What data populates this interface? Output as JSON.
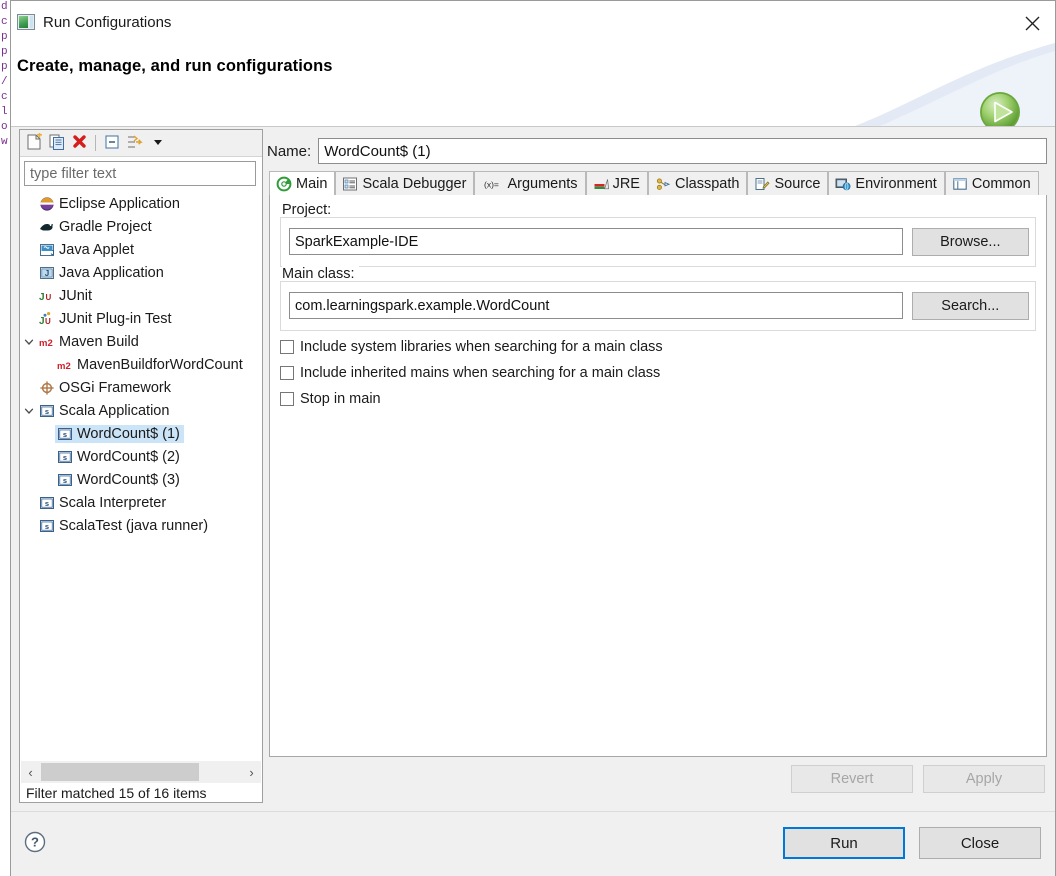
{
  "window": {
    "title": "Run Configurations",
    "title_icon": "run-config-icon",
    "close_icon": "close-icon"
  },
  "banner": {
    "heading": "Create, manage, and run configurations",
    "icon": "run-green-play-icon"
  },
  "tree_panel": {
    "toolbar": [
      {
        "name": "new-launch-configuration-icon",
        "tooltip": "New launch configuration"
      },
      {
        "name": "duplicate-icon",
        "tooltip": "Duplicate"
      },
      {
        "name": "delete-icon",
        "tooltip": "Delete"
      },
      {
        "name": "collapse-all-icon",
        "tooltip": "Collapse All"
      },
      {
        "name": "filter-icon",
        "tooltip": "Filter"
      },
      {
        "name": "chevron-down-icon",
        "tooltip": "Menu"
      }
    ],
    "filter": {
      "placeholder": "type filter text",
      "value": ""
    },
    "items": [
      {
        "label": "Eclipse Application",
        "icon": "eclipse-icon",
        "indent": 1,
        "expander": "none",
        "selected": false
      },
      {
        "label": "Gradle Project",
        "icon": "gradle-icon",
        "indent": 1,
        "expander": "none",
        "selected": false
      },
      {
        "label": "Java Applet",
        "icon": "java-applet-icon",
        "indent": 1,
        "expander": "none",
        "selected": false
      },
      {
        "label": "Java Application",
        "icon": "java-application-icon",
        "indent": 1,
        "expander": "none",
        "selected": false
      },
      {
        "label": "JUnit",
        "icon": "junit-icon",
        "indent": 1,
        "expander": "none",
        "selected": false
      },
      {
        "label": "JUnit Plug-in Test",
        "icon": "junit-plugin-icon",
        "indent": 1,
        "expander": "none",
        "selected": false
      },
      {
        "label": "Maven Build",
        "icon": "maven-icon",
        "indent": 0,
        "expander": "expanded",
        "selected": false
      },
      {
        "label": "MavenBuildforWordCount",
        "icon": "maven-icon",
        "indent": 2,
        "expander": "none",
        "selected": false
      },
      {
        "label": "OSGi Framework",
        "icon": "osgi-icon",
        "indent": 1,
        "expander": "none",
        "selected": false
      },
      {
        "label": "Scala Application",
        "icon": "scala-icon",
        "indent": 0,
        "expander": "expanded",
        "selected": false
      },
      {
        "label": "WordCount$ (1)",
        "icon": "scala-icon",
        "indent": 2,
        "expander": "none",
        "selected": true
      },
      {
        "label": "WordCount$ (2)",
        "icon": "scala-icon",
        "indent": 2,
        "expander": "none",
        "selected": false
      },
      {
        "label": "WordCount$ (3)",
        "icon": "scala-icon",
        "indent": 2,
        "expander": "none",
        "selected": false
      },
      {
        "label": "Scala Interpreter",
        "icon": "scala-icon",
        "indent": 1,
        "expander": "none",
        "selected": false
      },
      {
        "label": "ScalaTest (java runner)",
        "icon": "scala-icon",
        "indent": 1,
        "expander": "none",
        "selected": false
      }
    ],
    "scrollbar": {
      "left_arrow": "‹",
      "right_arrow": "›"
    },
    "status": "Filter matched 15 of 16 items"
  },
  "config": {
    "name_label": "Name:",
    "name_value": "WordCount$ (1)",
    "tabs": [
      {
        "label": "Main",
        "icon": "main-green-circle-icon",
        "active": true
      },
      {
        "label": "Scala Debugger",
        "icon": "scala-debugger-icon",
        "active": false
      },
      {
        "label": "Arguments",
        "icon": "arguments-icon",
        "active": false
      },
      {
        "label": "JRE",
        "icon": "jre-icon",
        "active": false
      },
      {
        "label": "Classpath",
        "icon": "classpath-icon",
        "active": false
      },
      {
        "label": "Source",
        "icon": "source-icon",
        "active": false
      },
      {
        "label": "Environment",
        "icon": "environment-icon",
        "active": false
      },
      {
        "label": "Common",
        "icon": "common-icon",
        "active": false
      }
    ],
    "project": {
      "group_label": "Project:",
      "value": "SparkExample-IDE",
      "button": "Browse..."
    },
    "main_class": {
      "group_label": "Main class:",
      "value": "com.learningspark.example.WordCount",
      "button": "Search..."
    },
    "checkboxes": [
      {
        "label": "Include system libraries when searching for a main class",
        "checked": false
      },
      {
        "label": "Include inherited mains when searching for a main class",
        "checked": false
      },
      {
        "label": "Stop in main",
        "checked": false
      }
    ],
    "revert_label": "Revert",
    "apply_label": "Apply"
  },
  "footer": {
    "help_icon": "help-question-icon",
    "run_label": "Run",
    "close_label": "Close"
  },
  "colors": {
    "selection_blue": "#cce4f7",
    "focus_blue": "#0078d7",
    "dialog_bg": "#f0f0f0",
    "run_green": "#5fae3d"
  },
  "background_code_lines": [
    "d",
    "c",
    "p",
    "p",
    "p",
    "/",
    "c",
    "",
    "",
    "",
    "",
    "",
    "",
    "",
    "",
    "",
    "",
    "",
    "",
    "",
    "",
    "",
    "",
    "",
    "",
    "",
    "",
    "",
    "l",
    "o",
    "w"
  ]
}
